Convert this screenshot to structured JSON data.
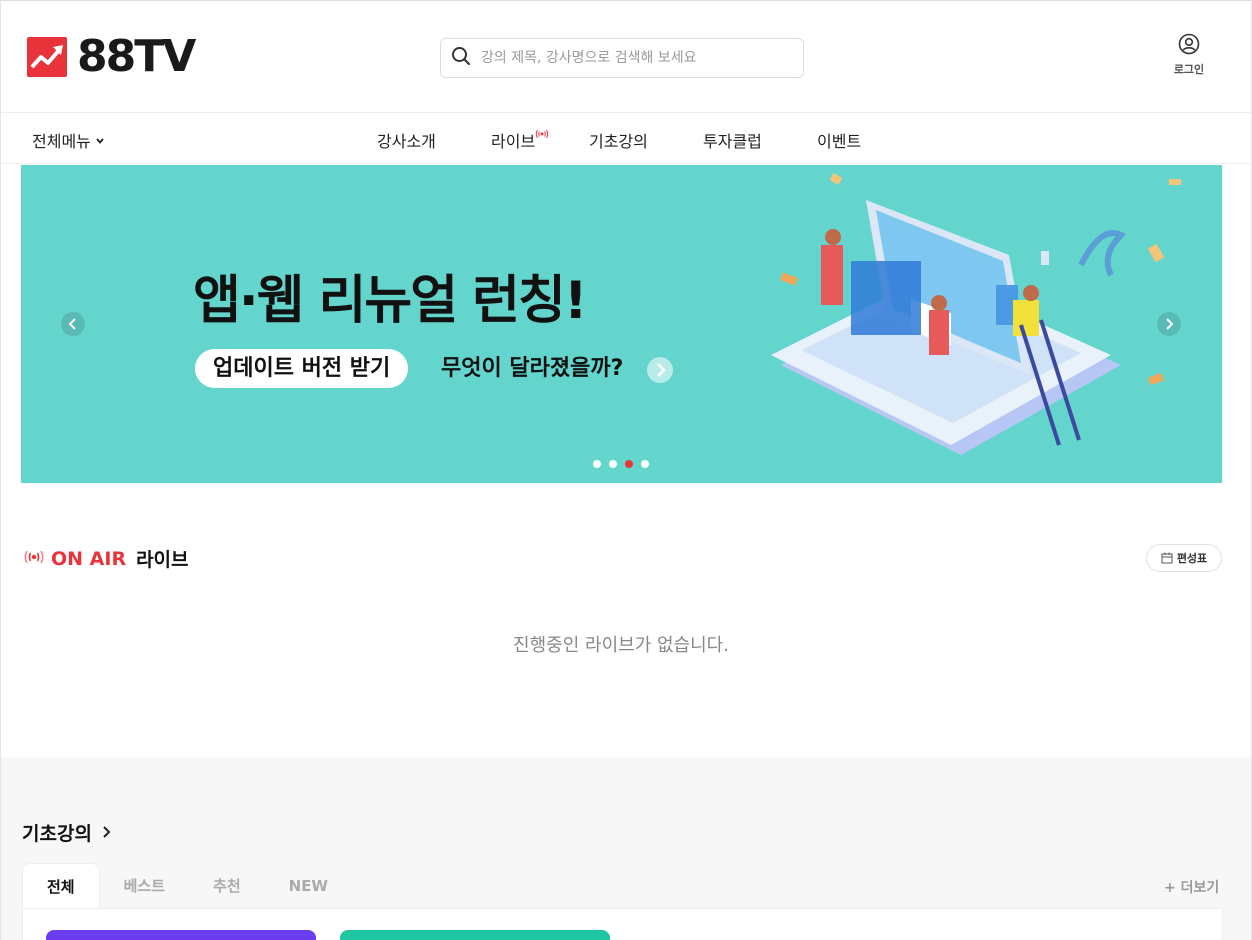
{
  "header": {
    "logo_text": "88TV",
    "search_placeholder": "강의 제목, 강사명으로 검색해 보세요",
    "login_label": "로그인"
  },
  "nav": {
    "all_menu": "전체메뉴",
    "items": [
      "강사소개",
      "라이브",
      "기초강의",
      "투자클럽",
      "이벤트"
    ]
  },
  "banner": {
    "title": "앱·웹 리뉴얼 런칭!",
    "pill": "업데이트 버전 받기",
    "subtitle": "무엇이 달라졌을까?",
    "background": "#63d5cd",
    "slide_count": 4,
    "active_slide": 3
  },
  "onair": {
    "label": "ON AIR",
    "title": "라이브",
    "schedule_label": "편성표",
    "empty_message": "진행중인 라이브가 없습니다."
  },
  "basic_course": {
    "title": "기초강의",
    "tabs": [
      "전체",
      "베스트",
      "추천",
      "NEW"
    ],
    "active_tab": 0,
    "more_label": "+ 더보기",
    "card_colors": [
      "#6b3cf0",
      "#1ec6a2"
    ]
  },
  "colors": {
    "brand_red": "#e8333a"
  }
}
